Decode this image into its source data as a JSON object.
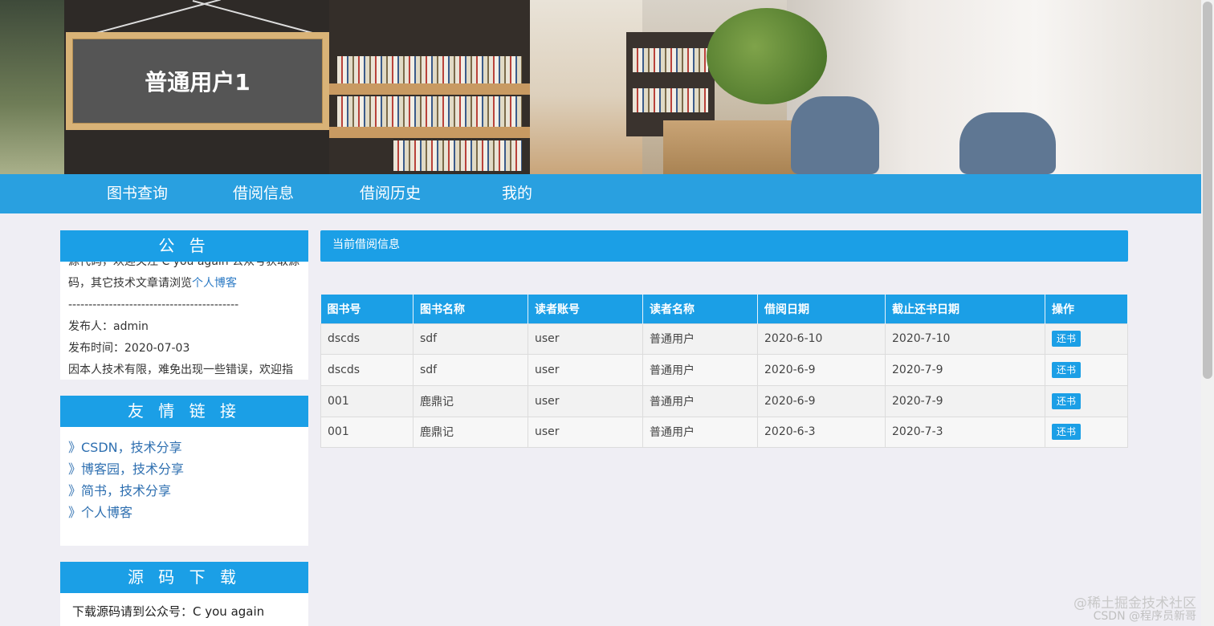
{
  "header": {
    "username_board": "普通用户1"
  },
  "nav": {
    "items": [
      "图书查询",
      "借阅信息",
      "借阅历史",
      "我的"
    ]
  },
  "notice": {
    "title": "公 告",
    "line_partial": "源代码，欢迎关注 C you again 公众号获取源",
    "line_text": "码，其它技术文章请浏览",
    "line_link": "个人博客",
    "divider": "------------------------------------------",
    "publisher": "发布人：admin",
    "publish_time": "发布时间：2020-07-03",
    "line_bottom": "因本人技术有限，难免出现一些错误，欢迎指正"
  },
  "links": {
    "title": "友 情 链 接",
    "items": [
      "》CSDN，技术分享",
      "》博客园，技术分享",
      "》简书，技术分享",
      "》个人博客"
    ]
  },
  "download": {
    "title": "源 码 下 载",
    "text": "下载源码请到公众号：C you again"
  },
  "main": {
    "title": "当前借阅信息",
    "columns": [
      "图书号",
      "图书名称",
      "读者账号",
      "读者名称",
      "借阅日期",
      "截止还书日期",
      "操作"
    ],
    "rows": [
      [
        "dscds",
        "sdf",
        "user",
        "普通用户",
        "2020-6-10",
        "2020-7-10"
      ],
      [
        "dscds",
        "sdf",
        "user",
        "普通用户",
        "2020-6-9",
        "2020-7-9"
      ],
      [
        "001",
        "鹿鼎记",
        "user",
        "普通用户",
        "2020-6-9",
        "2020-7-9"
      ],
      [
        "001",
        "鹿鼎记",
        "user",
        "普通用户",
        "2020-6-3",
        "2020-7-3"
      ]
    ],
    "action_label": "还书"
  },
  "watermark": {
    "line1": "@稀土掘金技术社区",
    "line2": "CSDN @程序员新哥"
  },
  "colors": {
    "primary": "#1b9fe6",
    "page_bg": "#efeef4"
  }
}
